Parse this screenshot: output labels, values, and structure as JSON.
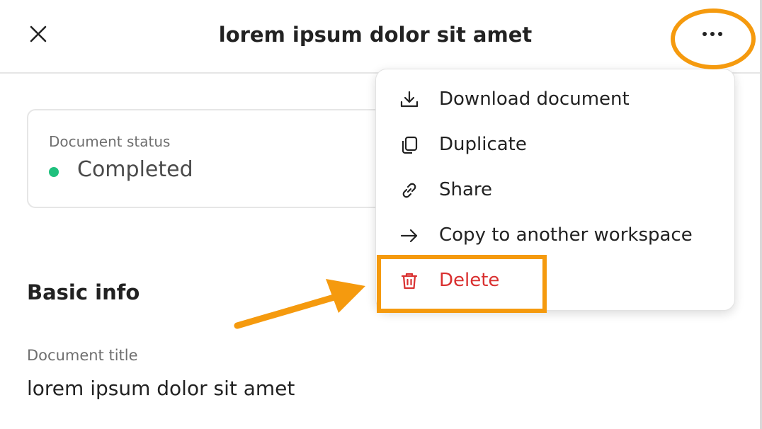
{
  "header": {
    "title": "lorem ipsum dolor sit amet"
  },
  "status_card": {
    "label": "Document status",
    "value": "Completed",
    "dot_color": "#1fc07d"
  },
  "basic_info": {
    "section_title": "Basic info",
    "field_label": "Document title",
    "field_value": "lorem ipsum dolor sit amet"
  },
  "menu": {
    "items": [
      {
        "label": "Download document",
        "icon": "download-icon"
      },
      {
        "label": "Duplicate",
        "icon": "copy-icon"
      },
      {
        "label": "Share",
        "icon": "link-icon"
      },
      {
        "label": "Copy to another workspace",
        "icon": "arrow-right-icon"
      },
      {
        "label": "Delete",
        "icon": "trash-icon",
        "danger": true
      }
    ]
  },
  "colors": {
    "highlight": "#f59a0e",
    "danger": "#d93030",
    "success": "#1fc07d"
  }
}
